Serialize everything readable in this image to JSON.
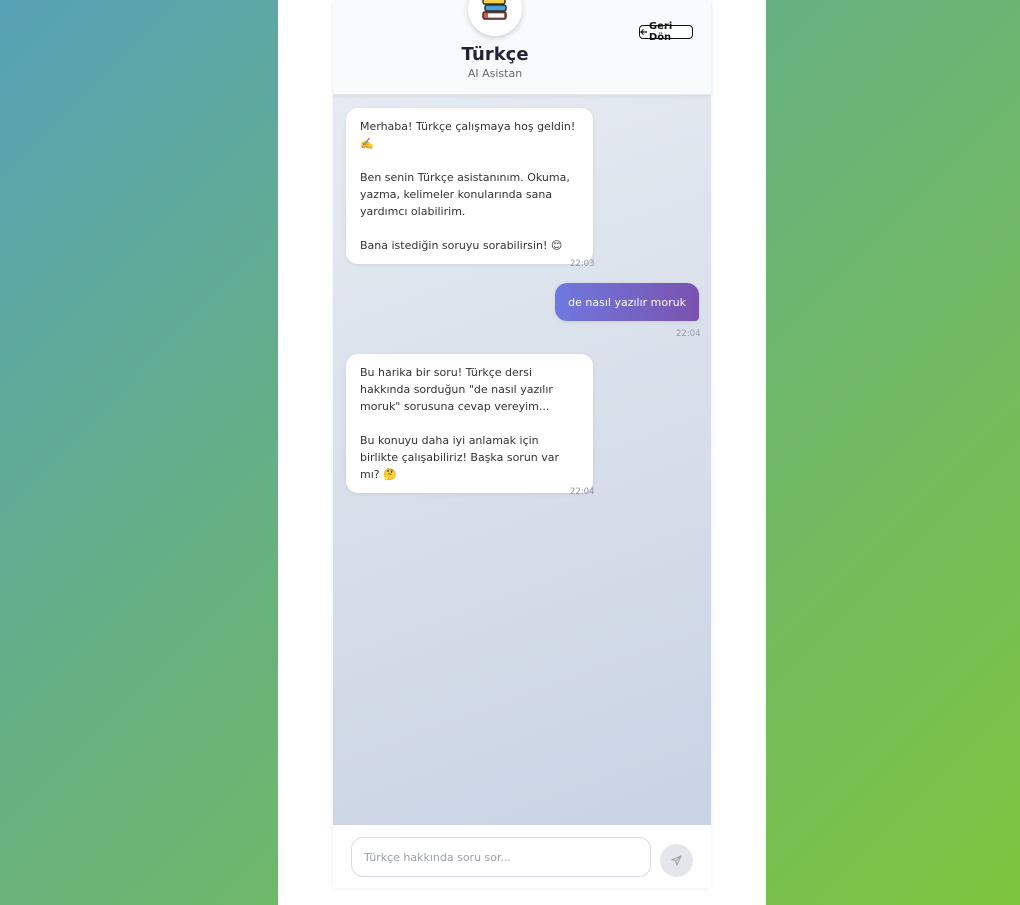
{
  "header": {
    "title": "Türkçe",
    "subtitle": "AI Asistan",
    "avatar_icon": "books-icon",
    "back_label": "Geri Dön"
  },
  "messages": [
    {
      "sender": "assistant",
      "text": "Merhaba! Türkçe çalışmaya hoş geldin! ✍️\n\nBen senin Türkçe asistanınım. Okuma, yazma, kelimeler konularında sana yardımcı olabilirim.\n\nBana istediğin soruyu sorabilirsin! 😊",
      "time": "22:03"
    },
    {
      "sender": "user",
      "text": "de nasıl yazılır moruk",
      "time": "22:04"
    },
    {
      "sender": "assistant",
      "text": "Bu harika bir soru! Türkçe dersi hakkında sorduğun \"de nasıl yazılır moruk\" sorusuna cevap vereyim...\n\nBu konuyu daha iyi anlamak için birlikte çalışabiliriz! Başka sorun var mı? 🤔",
      "time": "22:04"
    }
  ],
  "composer": {
    "placeholder": "Türkçe hakkında soru sor...",
    "value": "",
    "send_icon": "send-icon"
  },
  "colors": {
    "user_bubble_start": "#6f79de",
    "user_bubble_end": "#7a52b0",
    "background_start": "#57a2b6",
    "background_end": "#7ec53e"
  }
}
